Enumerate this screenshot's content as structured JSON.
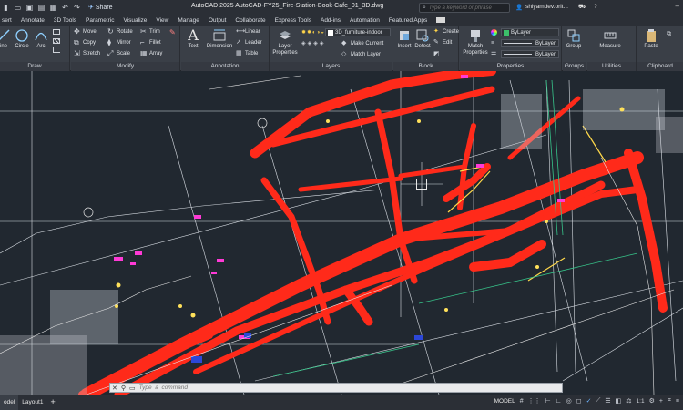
{
  "titlebar": {
    "share_label": "Share",
    "title": "AutoCAD 2025   AutoCAD-FY25_Fire-Station-Book-Cafe_01_3D.dwg",
    "search_placeholder": "Type a keyword or phrase",
    "user": "shiyamdev.orit..."
  },
  "tabs": [
    "sert",
    "Annotate",
    "3D Tools",
    "Parametric",
    "Visualize",
    "View",
    "Manage",
    "Output",
    "Collaborate",
    "Express Tools",
    "Add-ins",
    "Automation",
    "Featured Apps"
  ],
  "ribbon": {
    "draw": {
      "title": "Draw",
      "line": "ine",
      "circle": "Circle",
      "arc": "Arc"
    },
    "modify": {
      "title": "Modify",
      "move": "Move",
      "rotate": "Rotate",
      "trim": "Trim",
      "copy": "Copy",
      "mirror": "Mirror",
      "fillet": "Fillet",
      "stretch": "Stretch",
      "scale": "Scale",
      "array": "Array"
    },
    "annotation": {
      "title": "Annotation",
      "text": "Text",
      "dimension": "Dimension",
      "linear": "Linear",
      "leader": "Leader",
      "table": "Table"
    },
    "layers": {
      "title": "Layers",
      "layer_properties": "Layer Properties",
      "current_layer": "3D_furniture-indoor",
      "make_current": "Make Current",
      "match_layer": "Match Layer"
    },
    "block": {
      "title": "Block",
      "insert": "Insert",
      "detect": "Detect",
      "create": "Create",
      "edit": "Edit"
    },
    "properties": {
      "title": "Properties",
      "match_properties": "Match Properties",
      "color": "ByLayer",
      "linetype": "ByLayer",
      "lineweight": "ByLayer"
    },
    "groups": {
      "title": "Groups",
      "group": "Group"
    },
    "utilities": {
      "title": "Utilities",
      "measure": "Measure"
    },
    "clipboard": {
      "title": "Clipboard",
      "paste": "Paste"
    }
  },
  "command": {
    "placeholder": "Type  a  command"
  },
  "status": {
    "tab_model": "odel",
    "tab_layout": "Layout1",
    "add_layout": "+",
    "model_label": "MODEL",
    "scale": "1:1"
  },
  "colors": {
    "accent": "#ff2a1a",
    "canvas": "#212830",
    "ribbon": "#3a3f47",
    "lines": "#e8e8e8"
  }
}
